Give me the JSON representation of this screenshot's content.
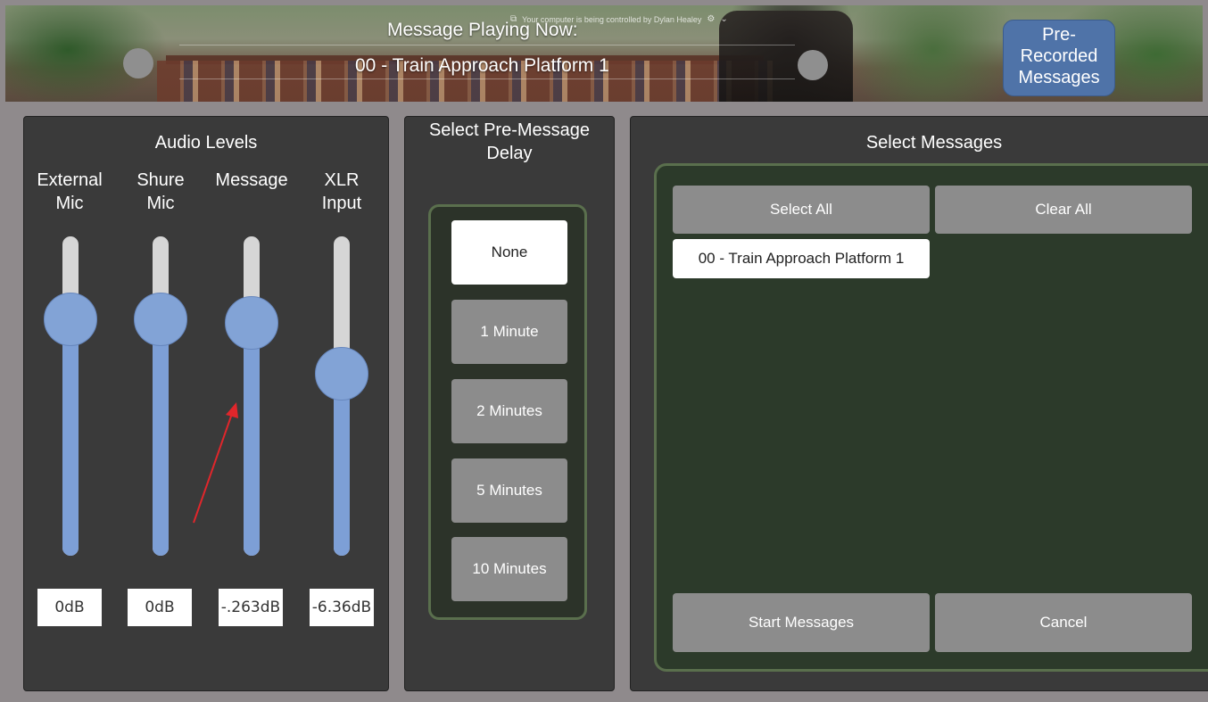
{
  "header": {
    "now_playing_label": "Message Playing Now:",
    "now_playing_title": "00 - Train Approach Platform 1",
    "remote_notice": "Your computer is being controlled by Dylan Healey",
    "prerecorded_button": [
      "Pre-",
      "Recorded",
      "Messages"
    ]
  },
  "audio": {
    "title": "Audio Levels",
    "channels": [
      {
        "label_lines": [
          "External",
          "Mic"
        ],
        "value": "0dB",
        "level": 0.74
      },
      {
        "label_lines": [
          "Shure",
          "Mic"
        ],
        "value": "0dB",
        "level": 0.74
      },
      {
        "label_lines": [
          "",
          "Message"
        ],
        "value": "-.263dB",
        "level": 0.73
      },
      {
        "label_lines": [
          "XLR",
          "Input"
        ],
        "value": "-6.36dB",
        "level": 0.57
      }
    ]
  },
  "delay": {
    "title_lines": [
      "Select Pre-Message",
      "Delay"
    ],
    "options": [
      "None",
      "1 Minute",
      "2 Minutes",
      "5 Minutes",
      "10 Minutes"
    ],
    "selected": "None"
  },
  "messages": {
    "title": "Select Messages",
    "select_all": "Select All",
    "clear_all": "Clear All",
    "items": [
      "00 - Train Approach Platform 1"
    ],
    "start": "Start Messages",
    "cancel": "Cancel"
  },
  "colors": {
    "slider_accent": "#7d9fd6",
    "panel_bg": "#3a3a3a",
    "group_border": "#5a6f4d",
    "button_gray": "#8c8c8c",
    "prerecorded_blue": "#4f73a8"
  }
}
